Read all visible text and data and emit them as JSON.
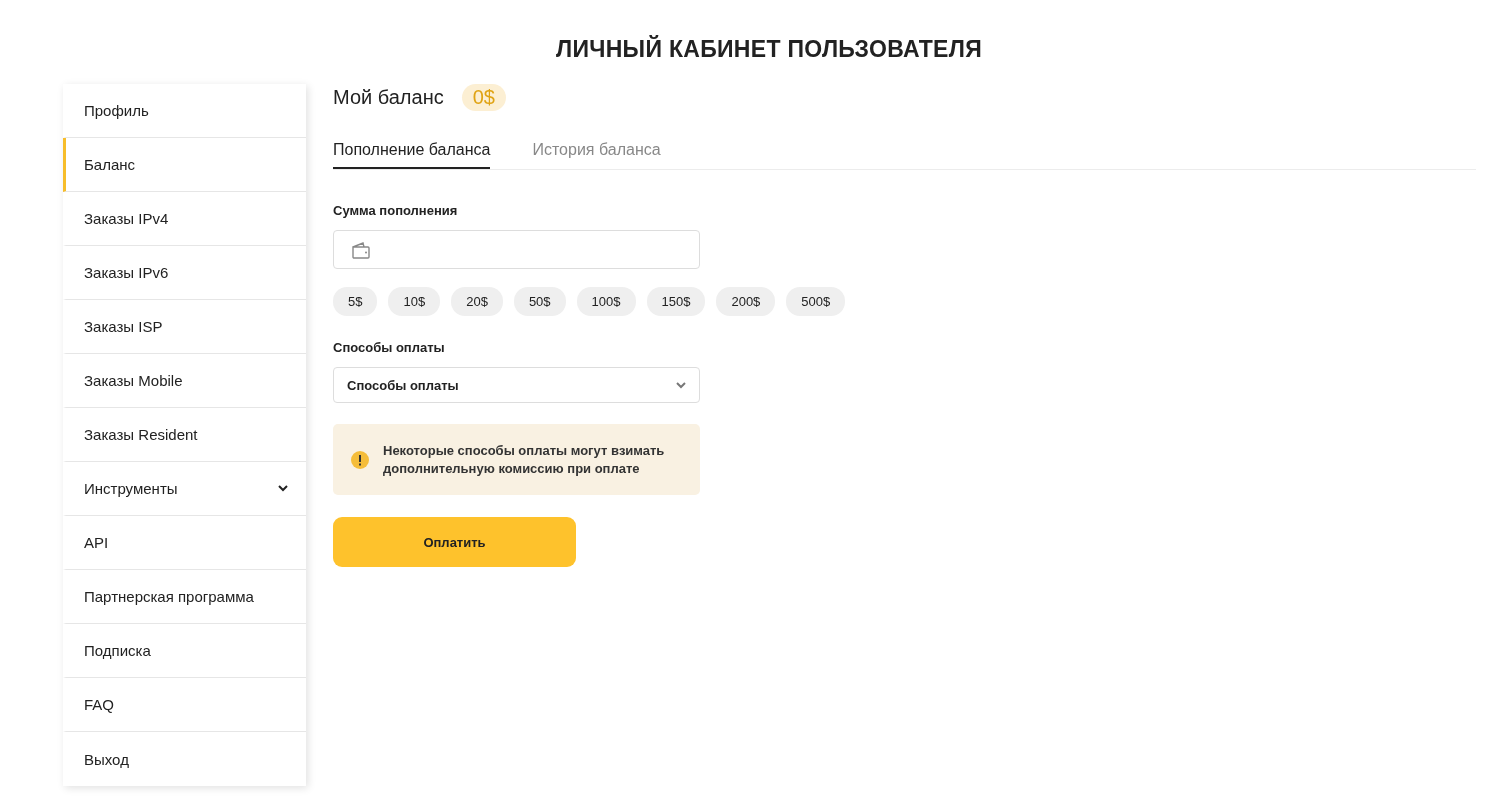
{
  "page_title": "ЛИЧНЫЙ КАБИНЕТ ПОЛЬЗОВАТЕЛЯ",
  "sidebar": {
    "items": [
      {
        "label": "Профиль",
        "selected": false
      },
      {
        "label": "Баланс",
        "selected": true
      },
      {
        "label": "Заказы IPv4",
        "selected": false
      },
      {
        "label": "Заказы IPv6",
        "selected": false
      },
      {
        "label": "Заказы ISP",
        "selected": false
      },
      {
        "label": "Заказы Mobile",
        "selected": false
      },
      {
        "label": "Заказы Resident",
        "selected": false
      },
      {
        "label": "Инструменты",
        "selected": false,
        "expanded": false
      },
      {
        "label": "API",
        "selected": false
      },
      {
        "label": "Партнерская программа",
        "selected": false
      },
      {
        "label": "Подписка",
        "selected": false
      },
      {
        "label": "FAQ",
        "selected": false
      },
      {
        "label": "Выход",
        "selected": false
      }
    ]
  },
  "balance": {
    "title": "Мой баланс",
    "amount": "0$"
  },
  "tabs": [
    {
      "label": "Пополнение баланса",
      "selected": true
    },
    {
      "label": "История баланса",
      "selected": false
    }
  ],
  "amount_field": {
    "label": "Сумма пополнения"
  },
  "presets": [
    "5$",
    "10$",
    "20$",
    "50$",
    "100$",
    "150$",
    "200$",
    "500$"
  ],
  "payment": {
    "label": "Способы оплаты",
    "value": "Способы оплаты"
  },
  "notice": "Некоторые способы оплаты могут взимать дополнительную комиссию при оплате",
  "pay_button": "Оплатить"
}
